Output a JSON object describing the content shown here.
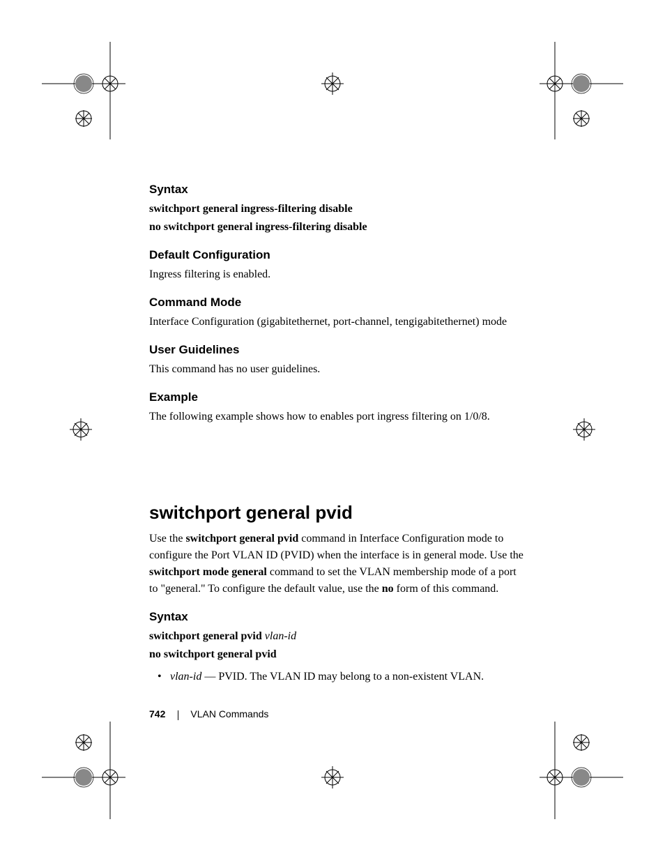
{
  "sections": {
    "syntax1": {
      "heading": "Syntax",
      "line1": "switchport general ingress-filtering disable",
      "line2": "no switchport general ingress-filtering disable"
    },
    "default_config": {
      "heading": "Default Configuration",
      "body": "Ingress filtering is enabled."
    },
    "command_mode": {
      "heading": "Command Mode",
      "body": "Interface Configuration (gigabitethernet, port-channel, tengigabitethernet) mode"
    },
    "user_guidelines": {
      "heading": "User Guidelines",
      "body": "This command has no user guidelines."
    },
    "example": {
      "heading": "Example",
      "body": "The following example shows how to enables port ingress filtering on 1/0/8."
    }
  },
  "main": {
    "heading": "switchport general pvid",
    "para": {
      "t1": "Use the ",
      "b1": "switchport general pvid",
      "t2": " command in Interface Configuration mode to configure the Port VLAN ID (PVID) when the interface is in general mode. Use the ",
      "b2": "switchport mode general",
      "t3": " command to set the VLAN membership mode of a port to \"general.\" To configure the default value, use the ",
      "b3": "no",
      "t4": " form of this command."
    }
  },
  "syntax2": {
    "heading": "Syntax",
    "line1": {
      "bold": "switchport general pvid ",
      "italic": "vlan-id"
    },
    "line2": "no switchport general pvid",
    "bullet": {
      "italic": "vlan-id",
      "rest": " — PVID. The VLAN ID may belong to a non-existent VLAN."
    }
  },
  "footer": {
    "page": "742",
    "section": "VLAN Commands"
  }
}
